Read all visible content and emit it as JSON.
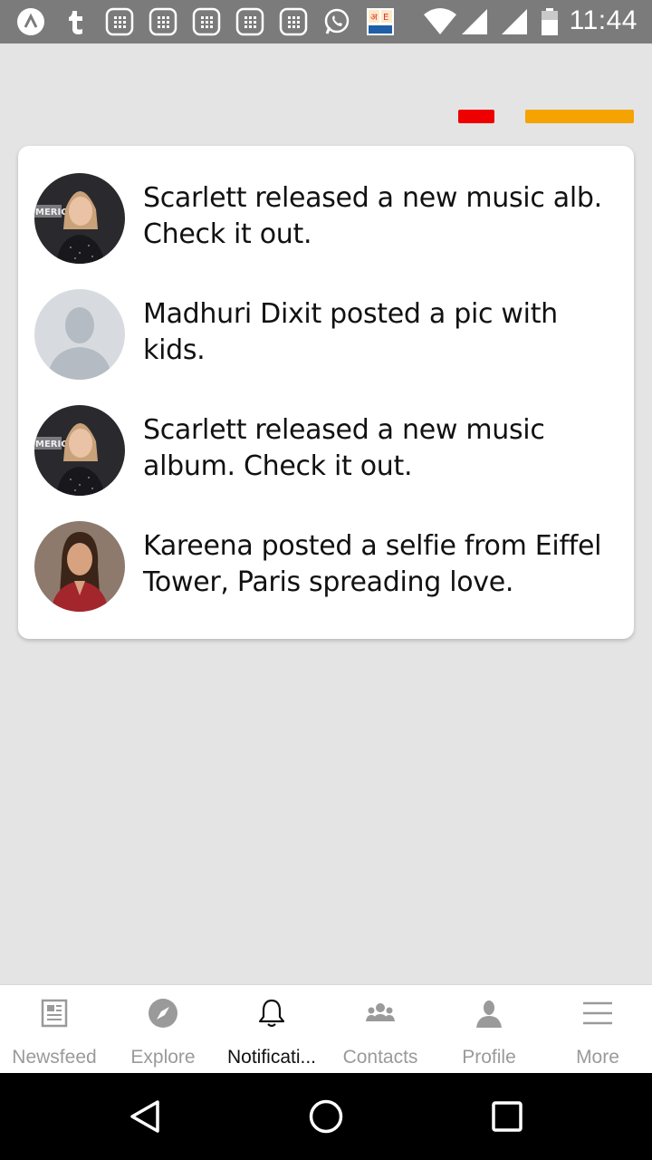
{
  "status_bar": {
    "time": "11:44",
    "icons": [
      "artstudio-icon",
      "tumblr-icon",
      "app-grid-icon",
      "app-grid-icon",
      "app-grid-icon",
      "app-grid-icon",
      "app-grid-icon",
      "whatsapp-icon",
      "dictionary-icon",
      "wifi-icon",
      "signal-icon",
      "signal-icon",
      "battery-icon"
    ]
  },
  "colors": {
    "accent_red": "#ee0000",
    "accent_orange": "#f5a300",
    "background": "#e4e4e4"
  },
  "notifications": [
    {
      "text": "Scarlett released a new music alb. Check it out.",
      "avatar": "scarlett-photo"
    },
    {
      "text": "Madhuri Dixit posted a pic with kids.",
      "avatar": "placeholder-avatar"
    },
    {
      "text": "Scarlett released a new music album. Check it out.",
      "avatar": "scarlett-photo"
    },
    {
      "text": "Kareena posted a selfie from Eiffel Tower, Paris spreading love.",
      "avatar": "kareena-photo"
    }
  ],
  "bottom_nav": {
    "active": "Notifications",
    "items": [
      {
        "label": "Newsfeed",
        "icon": "newspaper-icon"
      },
      {
        "label": "Explore",
        "icon": "compass-icon"
      },
      {
        "label": "Notificati...",
        "icon": "bell-icon"
      },
      {
        "label": "Contacts",
        "icon": "group-icon"
      },
      {
        "label": "Profile",
        "icon": "person-icon"
      },
      {
        "label": "More",
        "icon": "menu-icon"
      }
    ]
  }
}
